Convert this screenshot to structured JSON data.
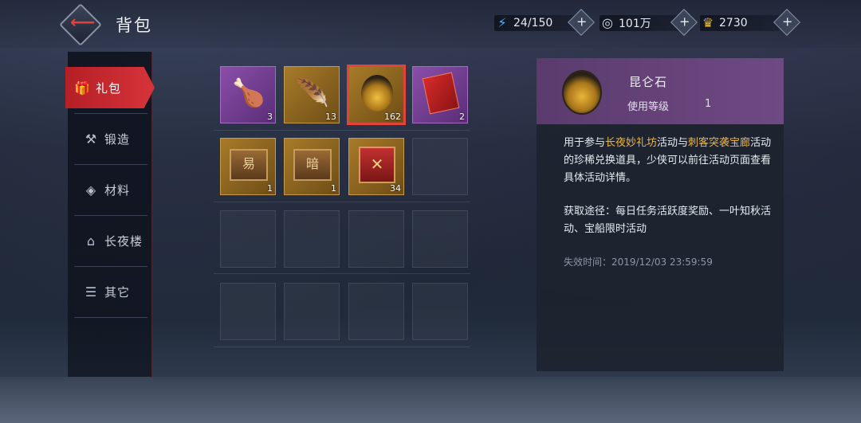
{
  "header": {
    "title": "背包",
    "resources": [
      {
        "icon": "lightning-icon",
        "value": "24/150"
      },
      {
        "icon": "coin-icon",
        "value": "101万"
      },
      {
        "icon": "gold-ingot-icon",
        "value": "2730"
      }
    ]
  },
  "sidebar": {
    "tabs": [
      {
        "label": "礼包",
        "icon": "gift-icon",
        "active": true
      },
      {
        "label": "锻造",
        "icon": "forge-icon",
        "active": false
      },
      {
        "label": "材料",
        "icon": "material-icon",
        "active": false
      },
      {
        "label": "长夜楼",
        "icon": "tower-icon",
        "active": false
      },
      {
        "label": "其它",
        "icon": "list-icon",
        "active": false
      }
    ]
  },
  "inventory": {
    "items": [
      {
        "icon": "roast-chicken-icon",
        "count": "3",
        "rarity": "purple"
      },
      {
        "icon": "peacock-feather-icon",
        "count": "13",
        "rarity": "gold"
      },
      {
        "icon": "kunlun-stone-icon",
        "count": "162",
        "rarity": "gold",
        "selected": true
      },
      {
        "icon": "red-envelope-icon",
        "count": "2",
        "rarity": "purple"
      },
      {
        "icon": "chest-yi-icon",
        "count": "1",
        "rarity": "gold"
      },
      {
        "icon": "chest-an-icon",
        "count": "1",
        "rarity": "gold"
      },
      {
        "icon": "red-box-icon",
        "count": "34",
        "rarity": "gold"
      }
    ]
  },
  "detail": {
    "name": "昆仑石",
    "level_label": "使用等级",
    "level_value": "1",
    "desc_p1": "用于参与",
    "desc_hl1": "长夜妙礼坊",
    "desc_p2": "活动与",
    "desc_hl2": "刺客突袭宝廊",
    "desc_p3": "活动的珍稀兑换道具，少侠可以前往活动页面查看具体活动详情。",
    "obtain": "获取途径：每日任务活跃度奖励、一叶知秋活动、宝船限时活动",
    "expire": "失效时间：2019/12/03 23:59:59",
    "accent": "#f0b838"
  }
}
